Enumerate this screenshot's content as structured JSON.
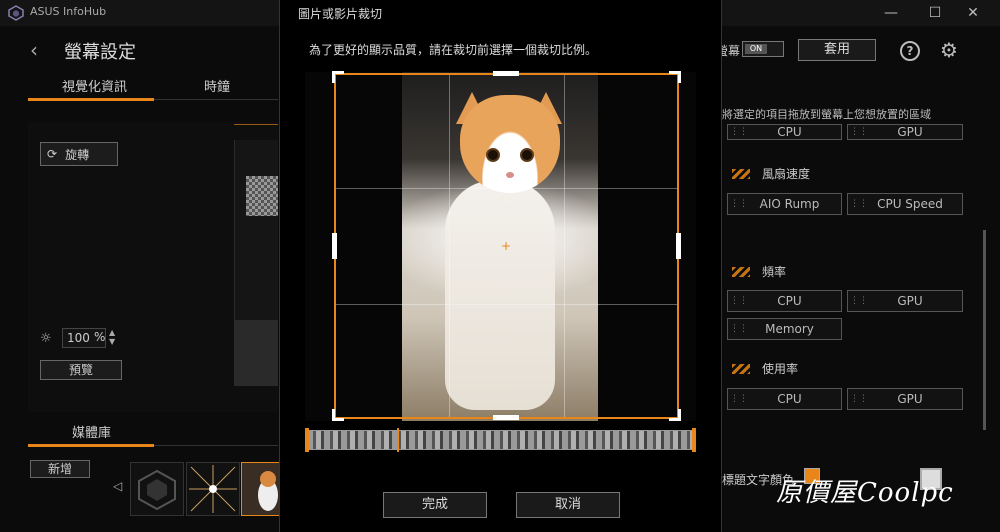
{
  "app": {
    "title": "ASUS InfoHub"
  },
  "window_controls": {
    "minimize": "—",
    "maximize": "☐",
    "close": "✕"
  },
  "left": {
    "back": "‹",
    "page_title": "螢幕設定",
    "tabs": [
      {
        "label": "視覺化資訊"
      },
      {
        "label": "時鐘"
      }
    ],
    "rotate_label": "旋轉",
    "brightness_value": "100",
    "brightness_unit": "%",
    "preview_label": "預覽",
    "media_title": "媒體庫",
    "add_label": "新增"
  },
  "right": {
    "screen_label": "螢幕",
    "toggle_label": "ON",
    "apply_label": "套用",
    "help": "?",
    "hint": "將選定的項目拖放到螢幕上您想放置的區域",
    "top_items": [
      "CPU",
      "GPU"
    ],
    "categories": [
      {
        "title": "風扇速度",
        "items": [
          "AIO Rump",
          "CPU Speed"
        ]
      },
      {
        "title": "頻率",
        "items": [
          "CPU",
          "GPU",
          "Memory"
        ]
      },
      {
        "title": "使用率",
        "items": [
          "CPU",
          "GPU"
        ]
      }
    ],
    "title_color_label": "標題文字顏色"
  },
  "modal": {
    "title": "圖片或影片裁切",
    "instruction": "為了更好的顯示品質，請在裁切前選擇一個裁切比例。",
    "done_label": "完成",
    "cancel_label": "取消"
  },
  "watermark": "原價屋Coolpc",
  "colors": {
    "accent": "#e8861a"
  }
}
